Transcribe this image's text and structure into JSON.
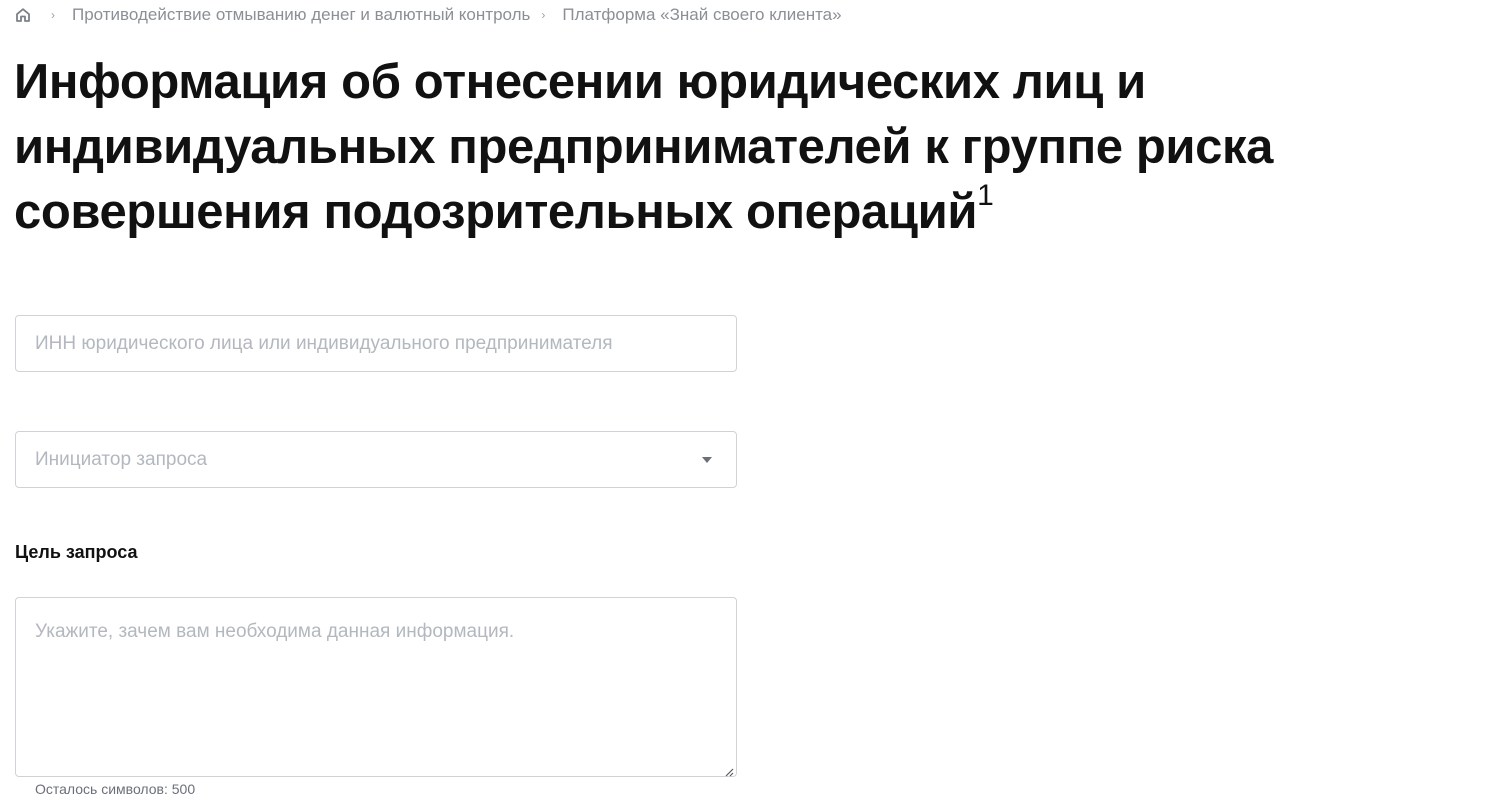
{
  "breadcrumb": {
    "home_icon": "home-icon",
    "items": [
      "Противодействие отмыванию денег и валютный контроль",
      "Платформа «Знай своего клиента»"
    ]
  },
  "page": {
    "title": "Информация об отнесении юридических лиц и индивидуальных предпринимателей к группе риска совершения подозрительных операций",
    "footnote_mark": "1"
  },
  "form": {
    "inn": {
      "value": "",
      "placeholder": "ИНН юридического лица или индивидуального предпринимателя"
    },
    "initiator": {
      "value": "",
      "placeholder": "Инициатор запроса",
      "icon": "chevron-down-icon"
    },
    "purpose": {
      "label": "Цель запроса",
      "value": "",
      "placeholder": "Укажите, зачем вам необходима данная информация."
    },
    "counter": "Осталось символов: 500"
  },
  "colors": {
    "text": "#111111",
    "muted": "#8b8f96",
    "placeholder": "#b3b8bf",
    "border": "#cfd3d8"
  }
}
